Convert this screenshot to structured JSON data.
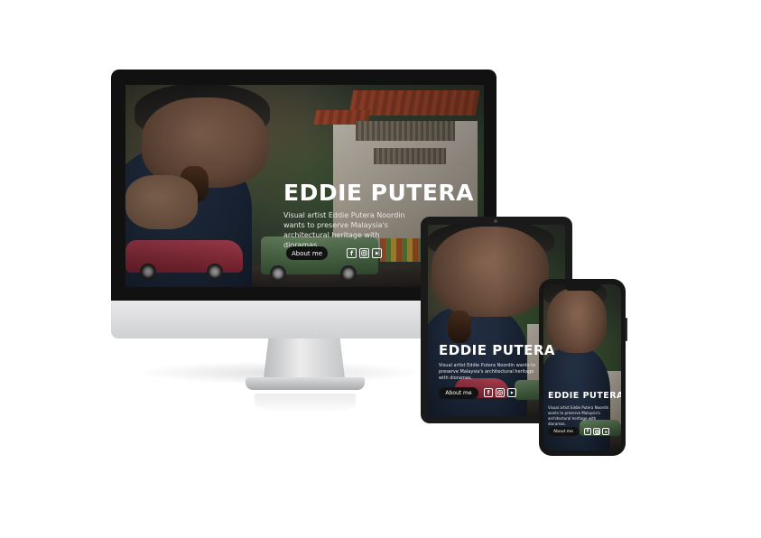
{
  "site": {
    "title": "EDDIE PUTERA",
    "tagline": "Visual artist Eddie Putera Noordin wants to preserve Malaysia's architectural heritage with dioramas.",
    "cta_label": "About me",
    "social": [
      {
        "icon": "facebook-icon",
        "glyph": "f"
      },
      {
        "icon": "instagram-icon",
        "glyph": ""
      },
      {
        "icon": "youtube-icon",
        "glyph": ""
      }
    ]
  },
  "devices": [
    "desktop-monitor",
    "tablet",
    "smartphone"
  ],
  "colors": {
    "background": "#ffffff",
    "button": "#121212",
    "text": "#ffffff",
    "frame": "#111111"
  }
}
